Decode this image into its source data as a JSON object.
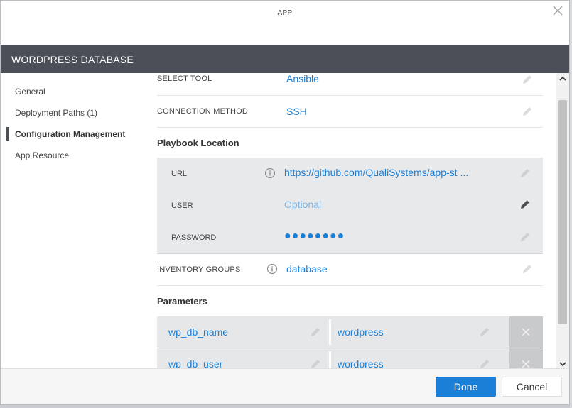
{
  "app": {
    "title": "APP"
  },
  "header": {
    "title": "WORDPRESS DATABASE"
  },
  "sidebar": {
    "items": [
      {
        "label": "General",
        "active": false
      },
      {
        "label": "Deployment Paths (1)",
        "active": false
      },
      {
        "label": "Configuration Management",
        "active": true
      },
      {
        "label": "App Resource",
        "active": false
      }
    ]
  },
  "config": {
    "select_tool": {
      "label": "SELECT TOOL",
      "value": "Ansible"
    },
    "connection_method": {
      "label": "CONNECTION METHOD",
      "value": "SSH"
    },
    "playbook_section": "Playbook Location",
    "url": {
      "label": "URL",
      "value": "https://github.com/QualiSystems/app-st ..."
    },
    "user": {
      "label": "USER",
      "placeholder": "Optional"
    },
    "password": {
      "label": "PASSWORD",
      "value": "●●●●●●●●"
    },
    "inventory_groups": {
      "label": "INVENTORY GROUPS",
      "value": "database"
    },
    "parameters_section": "Parameters",
    "parameters": [
      {
        "name": "wp_db_name",
        "value": "wordpress"
      },
      {
        "name": "wp_db_user",
        "value": "wordpress"
      }
    ]
  },
  "footer": {
    "done_label": "Done",
    "cancel_label": "Cancel"
  },
  "colors": {
    "accent": "#1a7fd6",
    "header_bg": "#4b4f57"
  }
}
